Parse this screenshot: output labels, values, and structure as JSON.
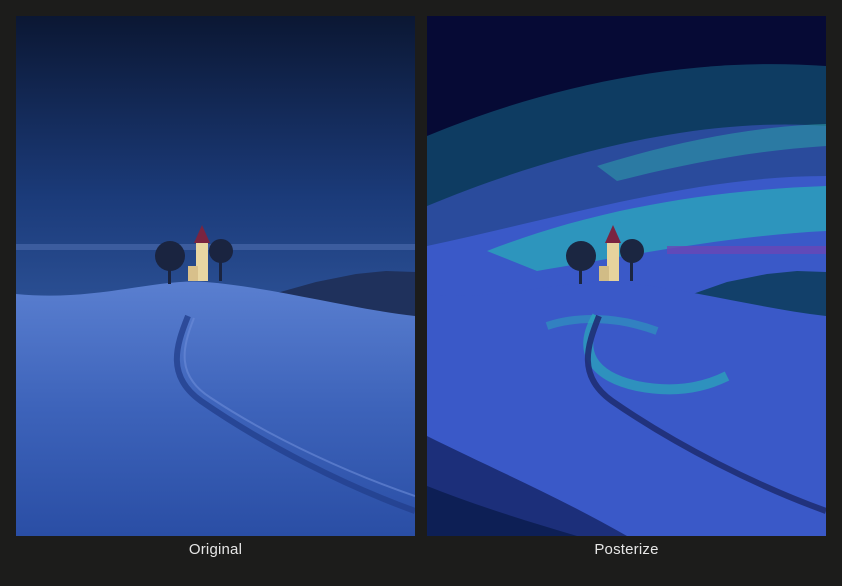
{
  "panels": [
    {
      "id": "original",
      "label": "Original"
    },
    {
      "id": "posterize",
      "label": "Posterize"
    }
  ],
  "colors": {
    "background": "#1c1c1b",
    "caption_text": "#e6e6e6",
    "original_sky_top": "#0d1b3a",
    "original_sky_bottom": "#3f69b6",
    "original_snow": "#3c63b8",
    "posterize_navy": "#060a35",
    "posterize_teal": "#0e3c62",
    "posterize_blue": "#3a59c8",
    "posterize_cyan": "#2aa9b9",
    "posterize_purple": "#6a46b5"
  }
}
